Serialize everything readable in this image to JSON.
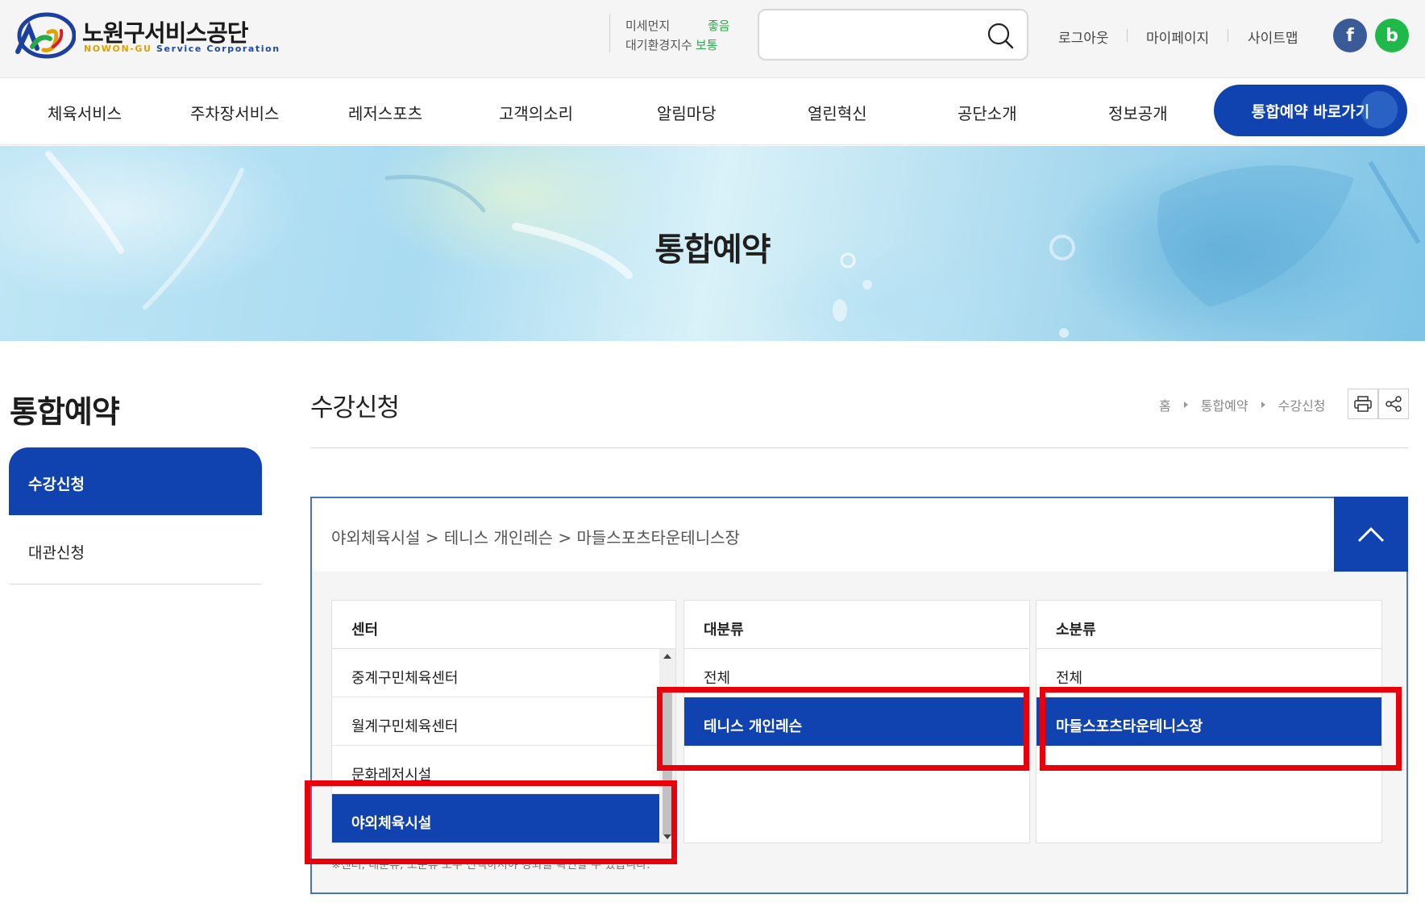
{
  "header": {
    "logo": {
      "name": "노원구서비스공단",
      "sub_highlight": "NOWON-GU",
      "sub_rest": "Service Corporation"
    },
    "air_quality": {
      "fine_dust_label": "미세먼지",
      "fine_dust_value": "좋음",
      "index_label": "대기환경지수",
      "index_value": "보통"
    },
    "search": {
      "placeholder": "",
      "value": ""
    },
    "util_links": [
      "로그아웃",
      "마이페이지",
      "사이트맵"
    ],
    "sns": {
      "facebook": "f",
      "blog": "b"
    }
  },
  "gnb": {
    "items": [
      "체육서비스",
      "주차장서비스",
      "레저스포츠",
      "고객의소리",
      "알림마당",
      "열린혁신",
      "공단소개",
      "정보공개"
    ],
    "cta": "통합예약 바로가기"
  },
  "banner": {
    "title": "통합예약"
  },
  "sidebar": {
    "title": "통합예약",
    "items": [
      {
        "label": "수강신청",
        "active": true
      },
      {
        "label": "대관신청",
        "active": false
      }
    ]
  },
  "content": {
    "title": "수강신청",
    "breadcrumb": [
      "홈",
      "통합예약",
      "수강신청"
    ]
  },
  "selector": {
    "path": "야외체육시설 > 테니스 개인레슨 > 마들스포츠타운테니스장",
    "columns": [
      {
        "header": "센터",
        "options": [
          "중계구민체육센터",
          "월계구민체육센터",
          "문화레저시설",
          "야외체육시설"
        ],
        "selected": "야외체육시설"
      },
      {
        "header": "대분류",
        "options": [
          "전체",
          "테니스 개인레슨"
        ],
        "selected": "테니스 개인레슨"
      },
      {
        "header": "소분류",
        "options": [
          "전체",
          "마들스포츠타운테니스장"
        ],
        "selected": "마들스포츠타운테니스장"
      }
    ],
    "note": "※센터, 대분류, 소분류 모두 선택하셔야 강좌를 확인할 수 있습니다."
  },
  "colors": {
    "primary": "#1143b0",
    "highlight": "#e8000b",
    "good": "#2aa94a"
  }
}
